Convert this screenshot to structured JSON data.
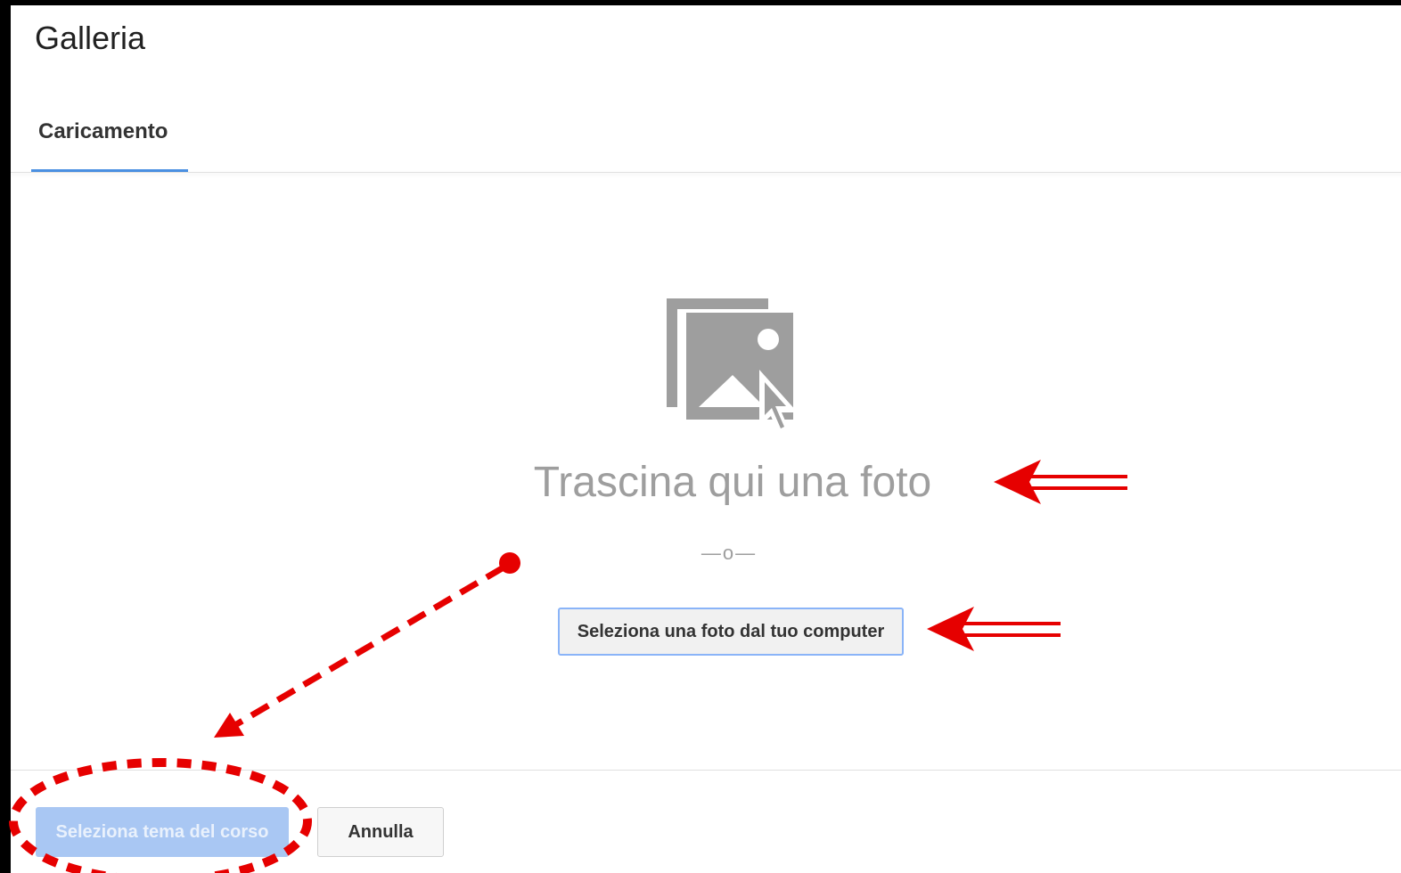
{
  "dialog": {
    "title": "Galleria"
  },
  "tabs": [
    {
      "label": "Caricamento",
      "active": true
    }
  ],
  "upload": {
    "drop_text": "Trascina qui una foto",
    "or_separator": "—o—",
    "select_button_label": "Seleziona una foto dal tuo computer",
    "icon": "photo-upload-icon"
  },
  "footer": {
    "primary_button_label": "Seleziona tema del corso",
    "primary_button_enabled": false,
    "cancel_button_label": "Annulla"
  },
  "colors": {
    "tab_underline": "#4a90e2",
    "primary_disabled": "#a9c7f3",
    "annotation": "#e60000",
    "icon_gray": "#9e9e9e"
  }
}
